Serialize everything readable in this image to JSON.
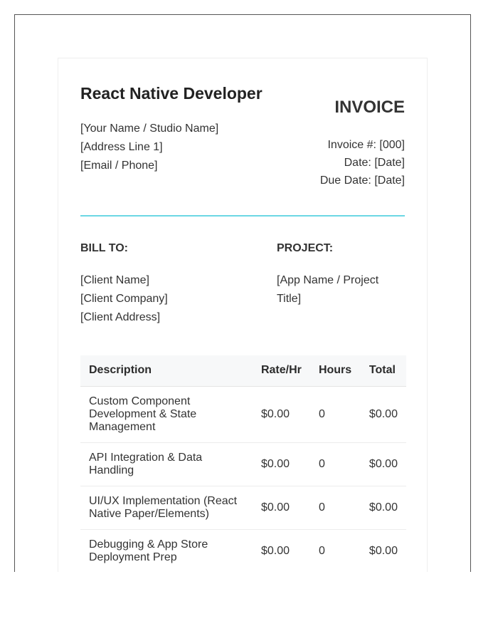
{
  "header": {
    "studio_title": "React Native Developer",
    "from_lines": [
      "[Your Name / Studio Name]",
      "[Address Line 1]",
      "[Email / Phone]"
    ],
    "invoice_title": "INVOICE",
    "invoice_number": "Invoice #: [000]",
    "date": "Date: [Date]",
    "due_date": "Due Date: [Date]"
  },
  "colors": {
    "accent_rule": "#6cd7e4"
  },
  "bill_to": {
    "label": "BILL TO:",
    "lines": [
      "[Client Name]",
      "[Client Company]",
      "[Client Address]"
    ]
  },
  "project": {
    "label": "PROJECT:",
    "lines": [
      "[App Name / Project Title]"
    ]
  },
  "items_table": {
    "headers": {
      "description": "Description",
      "rate": "Rate/Hr",
      "hours": "Hours",
      "total": "Total"
    },
    "rows": [
      {
        "description": "Custom Component Development & State Management",
        "rate": "$0.00",
        "hours": "0",
        "total": "$0.00"
      },
      {
        "description": "API Integration & Data Handling",
        "rate": "$0.00",
        "hours": "0",
        "total": "$0.00"
      },
      {
        "description": "UI/UX Implementation (React Native Paper/Elements)",
        "rate": "$0.00",
        "hours": "0",
        "total": "$0.00"
      },
      {
        "description": "Debugging & App Store Deployment Prep",
        "rate": "$0.00",
        "hours": "0",
        "total": "$0.00"
      }
    ]
  }
}
